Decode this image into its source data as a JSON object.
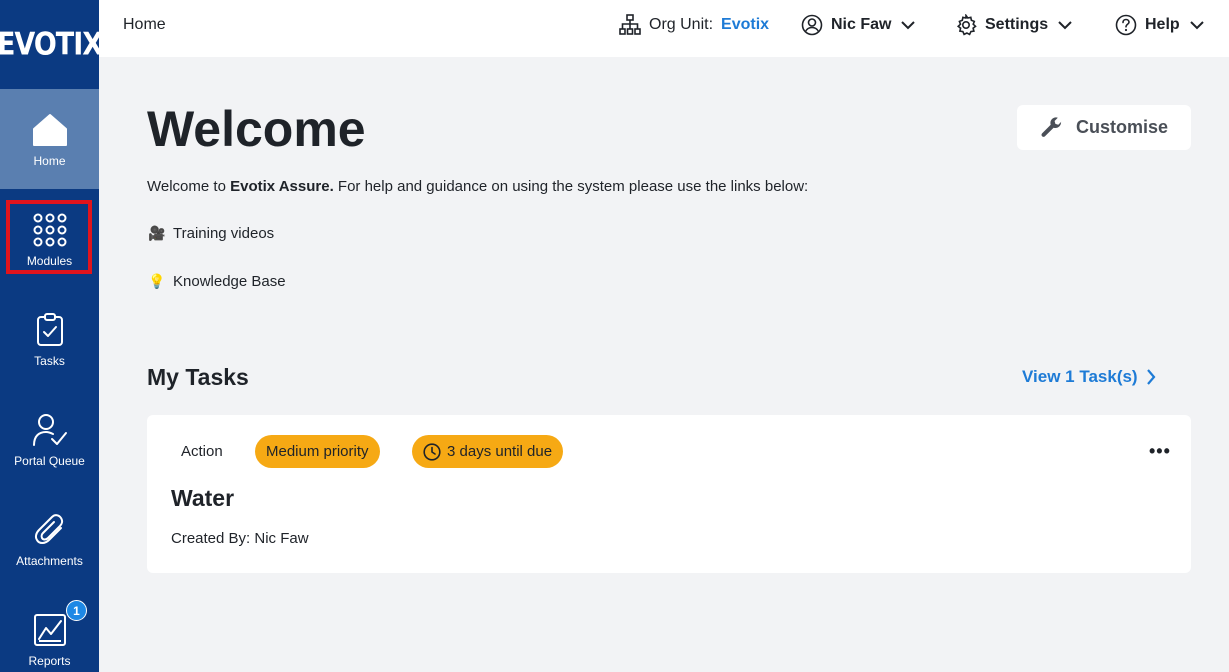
{
  "sidebar": {
    "logo": "EVOTIX",
    "items": [
      {
        "label": "Home",
        "icon": "home-icon"
      },
      {
        "label": "Modules",
        "icon": "grid-dots-icon"
      },
      {
        "label": "Tasks",
        "icon": "clipboard-check-icon"
      },
      {
        "label": "Portal Queue",
        "icon": "user-check-icon"
      },
      {
        "label": "Attachments",
        "icon": "paperclip-icon"
      },
      {
        "label": "Reports",
        "icon": "chart-report-icon",
        "badge": "1"
      }
    ]
  },
  "topbar": {
    "breadcrumb": "Home",
    "org_label": "Org Unit:",
    "org_value": "Evotix",
    "user": "Nic Faw",
    "settings": "Settings",
    "help": "Help"
  },
  "main": {
    "title": "Welcome",
    "customise_label": "Customise",
    "intro_prefix": "Welcome to ",
    "intro_bold": "Evotix Assure.",
    "intro_suffix": " For help and guidance on using the system please use the links below:",
    "links": [
      {
        "emoji": "🎥",
        "label": "Training videos"
      },
      {
        "emoji": "💡",
        "label": "Knowledge Base"
      }
    ],
    "tasks_title": "My Tasks",
    "view_tasks": "View 1 Task(s)",
    "task": {
      "type": "Action",
      "priority": "Medium priority",
      "due": "3 days until due",
      "name": "Water",
      "created_by": "Created By: Nic Faw",
      "more": "•••"
    }
  },
  "colors": {
    "sidebar": "#0b3a82",
    "sidebar_active": "#5a7fb0",
    "accent": "#1e7bd6",
    "pill": "#f6a914",
    "highlight": "#e1141c"
  }
}
